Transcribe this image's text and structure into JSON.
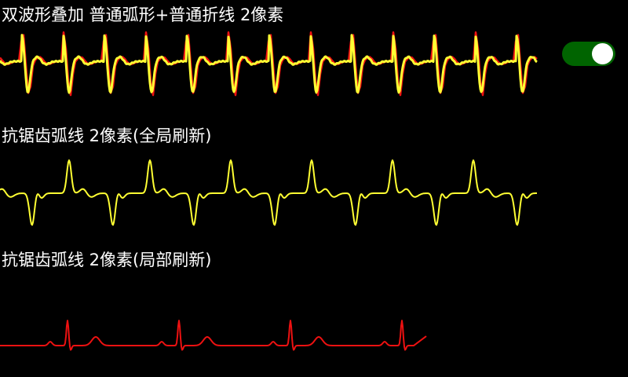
{
  "sections": {
    "overlay": {
      "title": "双波形叠加 普通弧形+普通折线 2像素",
      "series_colors": {
        "arc": "#ffff33",
        "polyline": "#ee1111"
      }
    },
    "antialias_full": {
      "title": "抗锯齿弧线 2像素(全局刷新)",
      "color": "#ffff33"
    },
    "antialias_partial": {
      "title": "抗锯齿弧线 2像素(局部刷新)",
      "color": "#ee1111"
    }
  },
  "toggle": {
    "state": "on",
    "track_color": "#006400",
    "knob_color": "#ffffff"
  }
}
